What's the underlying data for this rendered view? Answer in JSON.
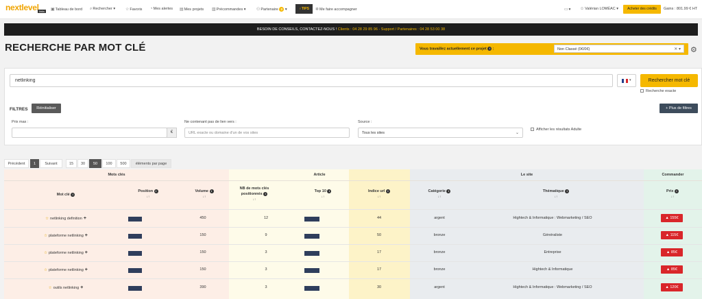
{
  "nav": {
    "logo": "nextlevel",
    "logo_sub": "links",
    "items": [
      {
        "icon": "dashboard-icon",
        "label": "Tableau de bord"
      },
      {
        "icon": "search-icon",
        "label": "Rechercher ▾"
      },
      {
        "icon": "star-icon",
        "label": "Favoris"
      },
      {
        "icon": "bell-icon",
        "label": "Mes alertes"
      },
      {
        "icon": "folder-icon",
        "label": "Mes projets"
      },
      {
        "icon": "list-icon",
        "label": "Précommandes ▾"
      },
      {
        "icon": "handshake-icon",
        "label": "Partenaire"
      }
    ],
    "partner_badge": "3",
    "tips": "TIPS",
    "accompany": "Me faire accompagner",
    "user": "Valérian LOMÉAC ▾",
    "buy_credits": "Acheter des crédits",
    "gains": "Gains : 801.99 € HT"
  },
  "banner": {
    "text": "BESOIN DE CONSEILS, CONTACTEZ-NOUS !",
    "clients": "Clients : 04 28 29 85 96",
    "support": "- Support / Partenaires : 04 28 53 00 38"
  },
  "page_title": "RECHERCHE PAR MOT CLÉ",
  "project": {
    "label": "Vous travaillez actuellement ce projet",
    "selected": "Non Classé (0€/0€)"
  },
  "search": {
    "value": "netlinking",
    "button": "Rechercher mot clé",
    "exact": "Recherche exacte"
  },
  "filters": {
    "label": "FILTRES",
    "reset": "Réinitialiser",
    "more": "+ Plus de filtres",
    "price_label": "Prix max :",
    "price_addon": "€",
    "nolink_label": "Ne contenant pas de lien vers :",
    "nolink_placeholder": "URL exacte ou domaine d'un de vos sites",
    "source_label": "Source :",
    "source_value": "Tous les sites",
    "adult": "Afficher les résultats Adulte"
  },
  "pagination": {
    "prev": "Précédent",
    "page": "1",
    "next": "Suivant",
    "sizes": [
      "15",
      "30",
      "50",
      "100",
      "500"
    ],
    "active_size": "50",
    "per_page": "éléments par page"
  },
  "table": {
    "groups": {
      "keywords": "Mots clés",
      "article": "Article",
      "site": "Le site",
      "order": "Commander"
    },
    "headers": {
      "keyword": "Mot clé",
      "position": "Position",
      "volume": "Volume",
      "nb_kw_1": "NB de mots clés",
      "nb_kw_2": "positionnés",
      "top10": "Top 10",
      "url_index": "Indice url",
      "category": "Catégorie",
      "theme": "Thématique",
      "price": "Prix"
    },
    "sort_glyph": "↓↑",
    "rows": [
      {
        "keyword": "netlinking definition",
        "volume": "450",
        "nb": "12",
        "url_index": "44",
        "category": "argent",
        "theme": "Hightech & Informatique : Webmarketing / SEO",
        "price": "155€"
      },
      {
        "keyword": "plateforme netlinking",
        "volume": "150",
        "nb": "9",
        "url_index": "50",
        "category": "bronze",
        "theme": "Généraliste",
        "price": "115€"
      },
      {
        "keyword": "plateforme netlinking",
        "volume": "150",
        "nb": "3",
        "url_index": "17",
        "category": "bronze",
        "theme": "Entreprise",
        "price": "85€"
      },
      {
        "keyword": "plateforme netlinking",
        "volume": "150",
        "nb": "3",
        "url_index": "17",
        "category": "bronze",
        "theme": "Hightech & Informatique",
        "price": "85€"
      },
      {
        "keyword": "outils netlinking",
        "volume": "390",
        "nb": "3",
        "url_index": "30",
        "category": "argent",
        "theme": "Hightech & Informatique : Webmarketing / SEO",
        "price": "120€"
      }
    ]
  },
  "colors": {
    "accent": "#f5b800",
    "danger": "#d9262a",
    "zone_keywords": "#fdeee6",
    "zone_article": "#fefbe9",
    "zone_url": "#fdf3c8",
    "zone_site": "#e9ecef",
    "zone_order": "#e3f3ea"
  }
}
